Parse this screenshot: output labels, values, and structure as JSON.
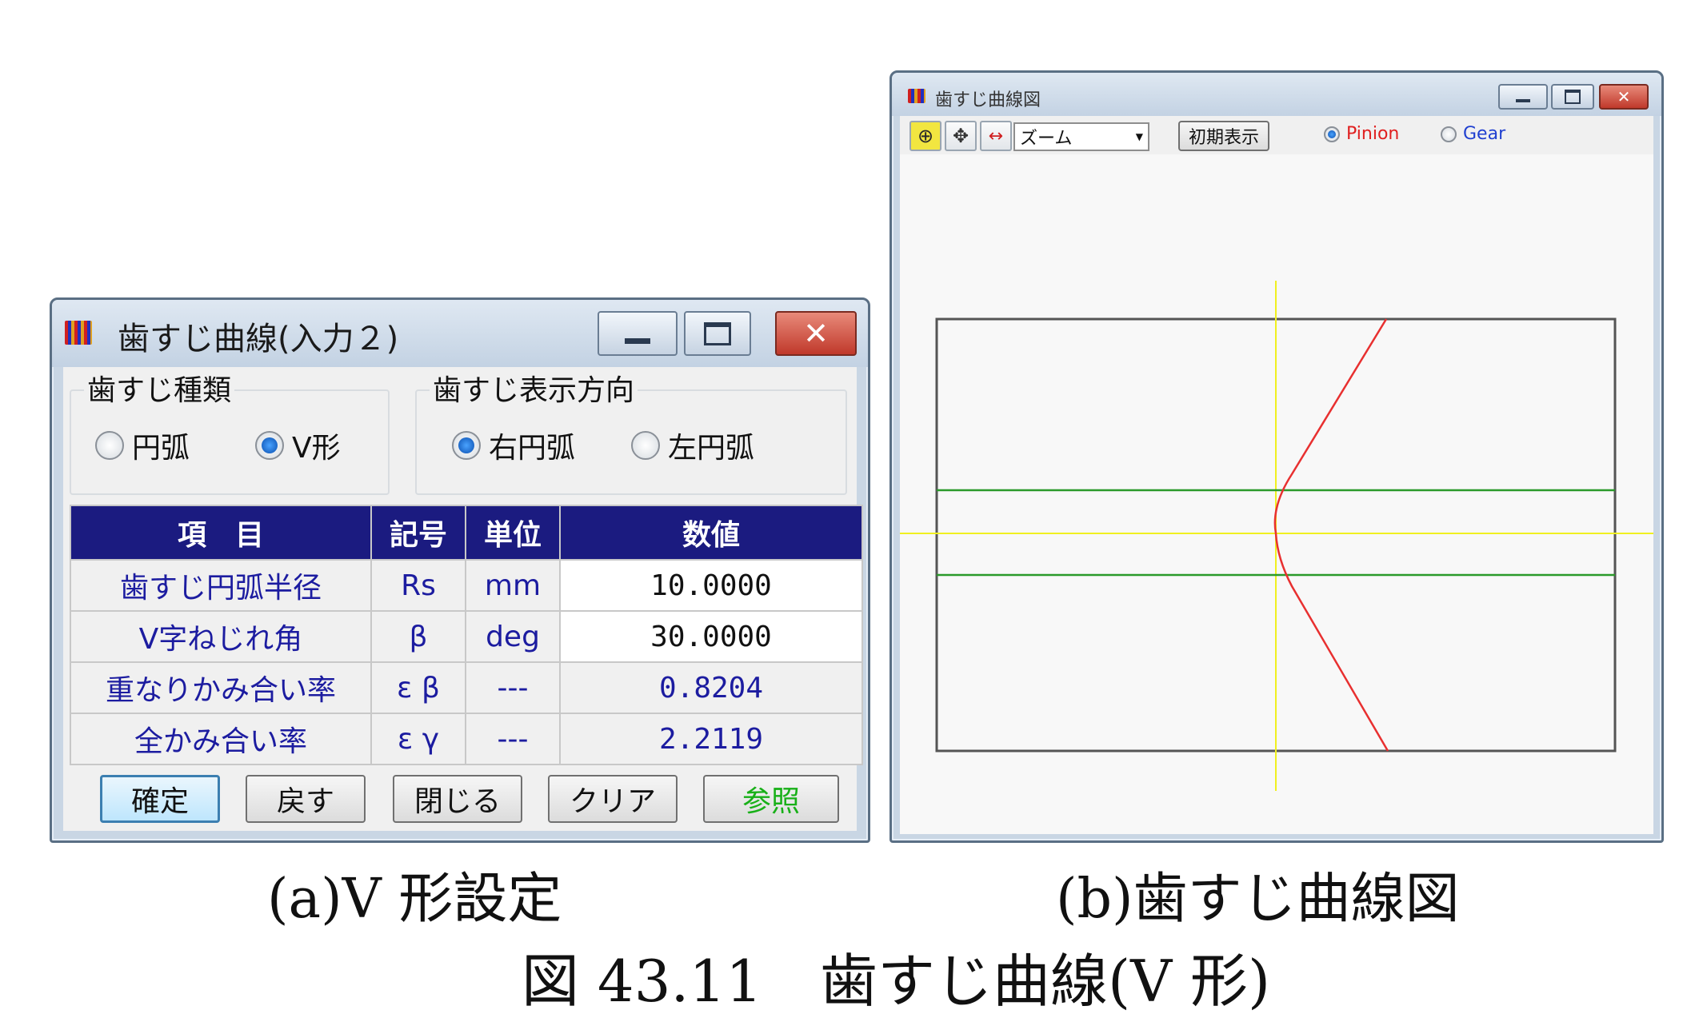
{
  "window_a": {
    "title": "歯すじ曲線(入力２)",
    "groups": {
      "type": {
        "label": "歯すじ種類",
        "options": [
          "円弧",
          "V形"
        ],
        "selected": "V形"
      },
      "direction": {
        "label": "歯すじ表示方向",
        "options": [
          "右円弧",
          "左円弧"
        ],
        "selected": "右円弧"
      }
    },
    "table": {
      "headers": [
        "項　目",
        "記号",
        "単位",
        "数値"
      ],
      "rows": [
        {
          "item": "歯すじ円弧半径",
          "symbol": "Rs",
          "unit": "mm",
          "value": "10.0000"
        },
        {
          "item": "V字ねじれ角",
          "symbol": "β",
          "unit": "deg",
          "value": "30.0000"
        },
        {
          "item": "重なりかみ合い率",
          "symbol": "ε β",
          "unit": "---",
          "value": "0.8204"
        },
        {
          "item": "全かみ合い率",
          "symbol": "ε γ",
          "unit": "---",
          "value": "2.2119"
        }
      ]
    },
    "buttons": {
      "confirm": "確定",
      "back": "戻す",
      "close": "閉じる",
      "clear": "クリア",
      "reference": "参照"
    },
    "colors": {
      "header_bg": "#1b1b80",
      "label_text": "#1c1ca0",
      "reference_text": "#18b018"
    }
  },
  "window_b": {
    "title": "歯すじ曲線図",
    "toolbar": {
      "zoom_select": "ズーム",
      "reset_button": "初期表示",
      "radio_pinion": "Pinion",
      "radio_gear": "Gear",
      "selected": "Pinion"
    },
    "colors": {
      "curve": "#e83030",
      "guide_lines": "#2a9a2a",
      "axis_lines": "#f0f020",
      "pinion_text": "#e02020",
      "gear_text": "#2040d0"
    }
  },
  "captions": {
    "a": "(a)V 形設定",
    "b": "(b)歯すじ曲線図",
    "figure": "図 43.11　歯すじ曲線(V 形)"
  }
}
